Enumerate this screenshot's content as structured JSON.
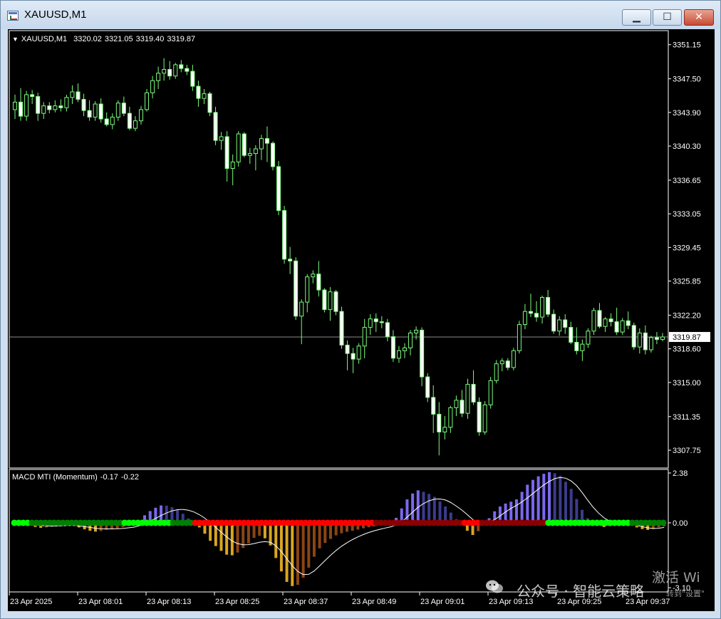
{
  "window": {
    "title": "XAUUSD,M1",
    "buttons": {
      "minimize": "▁",
      "maximize": "☐",
      "close": "✕"
    }
  },
  "symbol_header": {
    "symbol": "XAUUSD,M1",
    "open": "3320.02",
    "high": "3321.05",
    "low": "3319.40",
    "close": "3319.87"
  },
  "indicator_header": {
    "name": "MACD MTI (Momentum)",
    "value1": "-0.17",
    "value2": "-0.22"
  },
  "price_axis": {
    "labels": [
      "3351.15",
      "3347.50",
      "3343.90",
      "3340.30",
      "3336.65",
      "3333.05",
      "3329.45",
      "3325.85",
      "3322.20",
      "3318.60",
      "3315.00",
      "3311.35",
      "3307.75"
    ],
    "current_price_label": "3319.87"
  },
  "indicator_axis": {
    "labels": [
      "2.38",
      "0.00",
      "-3.10"
    ]
  },
  "time_axis": {
    "labels": [
      "23 Apr 2025",
      "23 Apr 08:01",
      "23 Apr 08:13",
      "23 Apr 08:25",
      "23 Apr 08:37",
      "23 Apr 08:49",
      "23 Apr 09:01",
      "23 Apr 09:13",
      "23 Apr 09:25",
      "23 Apr 09:37"
    ]
  },
  "colors": {
    "background": "#000000",
    "candle": "#7CFC7C",
    "bull_body": "#000000",
    "bear_body": "#FFFFFF",
    "hist_up": "#7B68EE",
    "hist_up_fading": "#3C3C8C",
    "hist_down": "#DAA520",
    "hist_down_fading": "#8B4513",
    "dot_green": "#00FF00",
    "dot_darkgreen": "#008000",
    "dot_red": "#FF0000",
    "dot_darkred": "#8B0000",
    "signal_line": "#FFFFFF",
    "price_line": "#A0A0A0"
  },
  "watermark": {
    "text": "公众号 · 智能云策略",
    "activate": "激活 Wi",
    "activate_sub": "转到\"设置\""
  },
  "chart_data": {
    "type": "candlestick",
    "title": "XAUUSD,M1",
    "timeframe": "M1",
    "ylim": [
      3306.0,
      3352.5
    ],
    "current_price": 3319.87,
    "candles": [
      [
        3344.2,
        3345.8,
        3343.2,
        3345.0
      ],
      [
        3345.0,
        3346.5,
        3343.0,
        3343.5
      ],
      [
        3343.5,
        3346.2,
        3343.0,
        3345.8
      ],
      [
        3345.8,
        3346.3,
        3344.8,
        3345.6
      ],
      [
        3345.6,
        3346.0,
        3343.0,
        3343.8
      ],
      [
        3343.8,
        3345.0,
        3343.2,
        3344.6
      ],
      [
        3344.6,
        3345.0,
        3343.8,
        3344.2
      ],
      [
        3344.2,
        3345.2,
        3343.9,
        3344.6
      ],
      [
        3344.6,
        3345.3,
        3344.0,
        3344.4
      ],
      [
        3344.4,
        3345.8,
        3344.0,
        3345.5
      ],
      [
        3345.5,
        3346.8,
        3344.8,
        3346.1
      ],
      [
        3346.1,
        3347.0,
        3345.0,
        3345.3
      ],
      [
        3345.3,
        3345.9,
        3343.5,
        3344.1
      ],
      [
        3344.1,
        3345.2,
        3343.0,
        3343.4
      ],
      [
        3343.4,
        3345.1,
        3343.0,
        3344.8
      ],
      [
        3344.8,
        3345.4,
        3342.8,
        3343.2
      ],
      [
        3343.2,
        3343.9,
        3342.4,
        3342.6
      ],
      [
        3342.6,
        3343.8,
        3342.1,
        3343.4
      ],
      [
        3343.4,
        3345.2,
        3343.0,
        3344.9
      ],
      [
        3344.9,
        3345.6,
        3343.5,
        3343.8
      ],
      [
        3343.8,
        3344.5,
        3342.0,
        3342.2
      ],
      [
        3342.2,
        3343.5,
        3341.9,
        3343.0
      ],
      [
        3343.0,
        3344.6,
        3342.6,
        3344.2
      ],
      [
        3344.2,
        3346.4,
        3344.0,
        3346.0
      ],
      [
        3346.0,
        3347.8,
        3345.4,
        3347.3
      ],
      [
        3347.3,
        3348.8,
        3346.4,
        3348.1
      ],
      [
        3348.1,
        3349.7,
        3347.3,
        3348.5
      ],
      [
        3348.5,
        3349.4,
        3347.4,
        3347.8
      ],
      [
        3347.8,
        3349.2,
        3347.5,
        3349.0
      ],
      [
        3349.0,
        3349.5,
        3348.2,
        3348.6
      ],
      [
        3348.6,
        3349.0,
        3347.9,
        3348.3
      ],
      [
        3348.3,
        3349.0,
        3346.2,
        3346.7
      ],
      [
        3346.7,
        3347.3,
        3344.5,
        3345.4
      ],
      [
        3345.4,
        3346.4,
        3344.8,
        3345.9
      ],
      [
        3345.9,
        3346.1,
        3343.5,
        3343.9
      ],
      [
        3343.9,
        3344.5,
        3340.4,
        3340.9
      ],
      [
        3340.9,
        3341.8,
        3339.9,
        3341.3
      ],
      [
        3341.3,
        3341.9,
        3336.5,
        3337.9
      ],
      [
        3337.9,
        3339.4,
        3336.1,
        3338.6
      ],
      [
        3338.6,
        3341.9,
        3338.1,
        3341.6
      ],
      [
        3341.6,
        3341.8,
        3339.1,
        3339.3
      ],
      [
        3339.3,
        3340.1,
        3338.4,
        3339.5
      ],
      [
        3339.5,
        3340.4,
        3337.7,
        3340.0
      ],
      [
        3340.0,
        3341.5,
        3338.8,
        3341.1
      ],
      [
        3341.1,
        3342.4,
        3338.6,
        3340.6
      ],
      [
        3340.6,
        3340.8,
        3337.7,
        3338.1
      ],
      [
        3338.1,
        3338.7,
        3332.9,
        3333.4
      ],
      [
        3333.4,
        3333.9,
        3327.7,
        3328.2
      ],
      [
        3328.2,
        3329.5,
        3326.6,
        3328.0
      ],
      [
        3328.0,
        3328.4,
        3321.7,
        3322.1
      ],
      [
        3322.1,
        3323.9,
        3319.1,
        3323.6
      ],
      [
        3323.6,
        3326.6,
        3322.5,
        3326.3
      ],
      [
        3326.3,
        3327.0,
        3325.6,
        3326.6
      ],
      [
        3326.6,
        3328.0,
        3324.2,
        3324.9
      ],
      [
        3324.9,
        3325.1,
        3322.5,
        3322.8
      ],
      [
        3322.8,
        3325.2,
        3321.6,
        3324.7
      ],
      [
        3324.7,
        3324.9,
        3322.2,
        3322.6
      ],
      [
        3322.6,
        3323.1,
        3318.6,
        3319.0
      ],
      [
        3319.0,
        3319.5,
        3316.3,
        3318.1
      ],
      [
        3318.1,
        3318.7,
        3316.0,
        3317.5
      ],
      [
        3317.5,
        3319.2,
        3317.0,
        3318.9
      ],
      [
        3318.9,
        3321.8,
        3317.6,
        3320.9
      ],
      [
        3320.9,
        3322.3,
        3320.1,
        3321.8
      ],
      [
        3321.8,
        3322.4,
        3320.4,
        3321.5
      ],
      [
        3321.5,
        3322.1,
        3320.8,
        3321.4
      ],
      [
        3321.4,
        3321.8,
        3319.4,
        3319.9
      ],
      [
        3319.9,
        3320.6,
        3317.2,
        3317.6
      ],
      [
        3317.6,
        3318.9,
        3317.1,
        3318.4
      ],
      [
        3318.4,
        3319.2,
        3317.6,
        3318.7
      ],
      [
        3318.7,
        3320.6,
        3317.9,
        3320.3
      ],
      [
        3320.3,
        3321.0,
        3319.6,
        3320.6
      ],
      [
        3320.6,
        3320.9,
        3314.6,
        3315.6
      ],
      [
        3315.6,
        3316.0,
        3312.9,
        3313.4
      ],
      [
        3313.4,
        3314.7,
        3309.6,
        3311.6
      ],
      [
        3311.6,
        3312.9,
        3307.2,
        3309.7
      ],
      [
        3309.7,
        3311.4,
        3308.9,
        3310.2
      ],
      [
        3310.2,
        3312.5,
        3309.6,
        3312.3
      ],
      [
        3312.3,
        3313.6,
        3311.4,
        3313.1
      ],
      [
        3313.1,
        3314.2,
        3311.3,
        3311.7
      ],
      [
        3311.7,
        3315.4,
        3311.1,
        3314.8
      ],
      [
        3314.8,
        3316.3,
        3312.6,
        3312.9
      ],
      [
        3312.9,
        3313.4,
        3309.3,
        3309.7
      ],
      [
        3309.7,
        3313.0,
        3309.4,
        3312.6
      ],
      [
        3312.6,
        3315.6,
        3312.2,
        3315.2
      ],
      [
        3315.2,
        3317.4,
        3314.9,
        3317.0
      ],
      [
        3317.0,
        3317.6,
        3316.2,
        3317.3
      ],
      [
        3317.3,
        3317.6,
        3316.3,
        3316.6
      ],
      [
        3316.6,
        3318.7,
        3316.3,
        3318.4
      ],
      [
        3318.4,
        3321.6,
        3318.1,
        3321.2
      ],
      [
        3321.2,
        3323.4,
        3320.7,
        3322.6
      ],
      [
        3322.6,
        3324.5,
        3322.0,
        3322.4
      ],
      [
        3322.4,
        3323.7,
        3321.5,
        3322.0
      ],
      [
        3322.0,
        3324.3,
        3321.3,
        3324.1
      ],
      [
        3324.1,
        3324.9,
        3322.0,
        3322.3
      ],
      [
        3322.3,
        3322.8,
        3320.2,
        3320.5
      ],
      [
        3320.5,
        3322.1,
        3320.0,
        3321.7
      ],
      [
        3321.7,
        3322.3,
        3320.2,
        3320.9
      ],
      [
        3320.9,
        3321.5,
        3319.1,
        3319.3
      ],
      [
        3319.3,
        3320.9,
        3318.0,
        3318.4
      ],
      [
        3318.4,
        3319.6,
        3317.3,
        3319.1
      ],
      [
        3319.1,
        3320.8,
        3318.7,
        3320.5
      ],
      [
        3320.5,
        3323.0,
        3320.1,
        3322.7
      ],
      [
        3322.7,
        3323.5,
        3320.8,
        3321.0
      ],
      [
        3321.0,
        3322.0,
        3320.4,
        3321.8
      ],
      [
        3321.8,
        3322.4,
        3321.0,
        3321.5
      ],
      [
        3321.5,
        3323.0,
        3320.1,
        3320.4
      ],
      [
        3320.4,
        3321.9,
        3320.1,
        3321.6
      ],
      [
        3321.6,
        3322.6,
        3320.7,
        3321.1
      ],
      [
        3321.1,
        3321.4,
        3318.5,
        3318.8
      ],
      [
        3318.8,
        3320.8,
        3318.1,
        3320.3
      ],
      [
        3320.3,
        3321.1,
        3318.0,
        3318.5
      ],
      [
        3318.5,
        3320.0,
        3318.2,
        3319.8
      ],
      [
        3319.8,
        3320.4,
        3319.1,
        3319.6
      ],
      [
        3319.6,
        3320.3,
        3319.4,
        3319.87
      ]
    ],
    "indicator": {
      "name": "MACD MTI (Momentum)",
      "ylim": [
        -3.3,
        2.55
      ],
      "histogram": [
        0.04,
        0.02,
        -0.03,
        -0.12,
        -0.2,
        -0.24,
        -0.22,
        -0.18,
        -0.14,
        -0.1,
        -0.08,
        -0.11,
        -0.22,
        -0.31,
        -0.38,
        -0.42,
        -0.39,
        -0.33,
        -0.28,
        -0.26,
        -0.21,
        -0.15,
        -0.06,
        0.12,
        0.36,
        0.56,
        0.72,
        0.83,
        0.82,
        0.74,
        0.61,
        0.43,
        0.21,
        0.02,
        -0.22,
        -0.52,
        -0.86,
        -1.11,
        -1.34,
        -1.52,
        -1.55,
        -1.42,
        -1.2,
        -0.98,
        -0.72,
        -0.62,
        -0.74,
        -1.08,
        -1.68,
        -2.32,
        -2.82,
        -3.02,
        -2.96,
        -2.62,
        -2.14,
        -1.62,
        -1.22,
        -0.96,
        -0.77,
        -0.6,
        -0.5,
        -0.43,
        -0.38,
        -0.32,
        -0.26,
        -0.21,
        -0.17,
        -0.12,
        -0.06,
        0.04,
        0.24,
        0.69,
        1.12,
        1.4,
        1.55,
        1.48,
        1.38,
        1.24,
        1.02,
        0.78,
        0.49,
        0.18,
        -0.08,
        -0.38,
        -0.58,
        -0.4,
        -0.08,
        0.22,
        0.55,
        0.78,
        0.92,
        1.01,
        1.12,
        1.48,
        1.82,
        2.05,
        2.22,
        2.34,
        2.42,
        2.37,
        2.24,
        1.96,
        1.62,
        1.14,
        0.62,
        0.22,
        -0.02,
        -0.12,
        -0.2,
        -0.16,
        -0.12,
        -0.08,
        -0.06,
        -0.1,
        -0.22,
        -0.3,
        -0.34,
        -0.3,
        -0.22,
        -0.17
      ],
      "signal": [
        0.03,
        0.02,
        0.0,
        -0.04,
        -0.09,
        -0.13,
        -0.15,
        -0.16,
        -0.15,
        -0.14,
        -0.13,
        -0.13,
        -0.15,
        -0.18,
        -0.22,
        -0.26,
        -0.28,
        -0.29,
        -0.29,
        -0.28,
        -0.27,
        -0.24,
        -0.21,
        -0.14,
        -0.04,
        0.08,
        0.21,
        0.35,
        0.47,
        0.57,
        0.63,
        0.64,
        0.6,
        0.52,
        0.39,
        0.22,
        0.01,
        -0.22,
        -0.45,
        -0.67,
        -0.87,
        -0.99,
        -1.05,
        -1.04,
        -0.99,
        -0.93,
        -0.9,
        -0.93,
        -1.1,
        -1.37,
        -1.71,
        -2.05,
        -2.32,
        -2.47,
        -2.46,
        -2.3,
        -2.06,
        -1.8,
        -1.55,
        -1.32,
        -1.12,
        -0.95,
        -0.8,
        -0.67,
        -0.56,
        -0.46,
        -0.38,
        -0.31,
        -0.25,
        -0.19,
        -0.11,
        0.05,
        0.27,
        0.51,
        0.74,
        0.92,
        1.05,
        1.13,
        1.14,
        1.09,
        0.97,
        0.8,
        0.61,
        0.39,
        0.16,
        0.03,
        -0.03,
        0.03,
        0.15,
        0.33,
        0.52,
        0.69,
        0.83,
        1.0,
        1.19,
        1.4,
        1.61,
        1.81,
        1.98,
        2.11,
        2.17,
        2.13,
        2.0,
        1.77,
        1.45,
        1.09,
        0.75,
        0.47,
        0.24,
        0.08,
        -0.02,
        -0.07,
        -0.08,
        -0.08,
        -0.12,
        -0.18,
        -0.24,
        -0.27,
        -0.26,
        -0.22
      ],
      "dots": "GGGGgggggggggggggggggggggGGGGGGGGGGGgggggRRRRRRRRRRRRRRRRRRRRRRRRRRRRRRRRRRRRRRRRRrrrrrrrrrrrrrrrrrrrrRRRRrrrrrrrrrrrrrrrGGGGGGGGGGGGGGGGGGGgggggggg"
    }
  }
}
